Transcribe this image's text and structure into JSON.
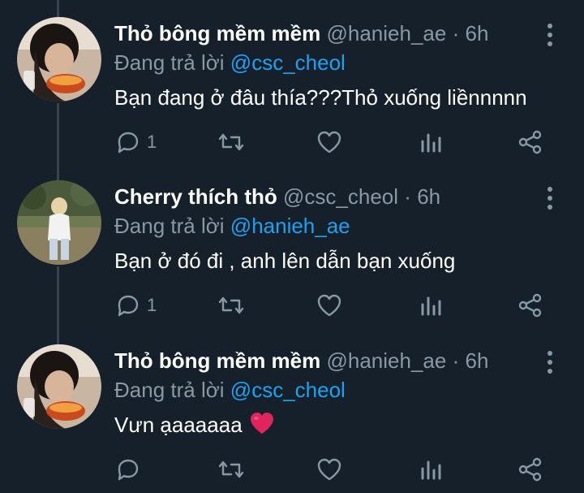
{
  "replying_to_label": "Đang trả lời",
  "colors": {
    "background": "#15202b",
    "secondary_text": "#8899a6",
    "accent": "#1da1f2",
    "heart": "#e0245e"
  },
  "tweets": [
    {
      "name": "Thỏ bông mềm mềm",
      "handle": "@hanieh_ae",
      "separator": "·",
      "time": "6h",
      "reply_to": "@csc_cheol",
      "text": "Bạn đang ở đâu thía???Thỏ xuống liềnnnnn",
      "reply_count": "1",
      "avatar": "avatar-eating-photo"
    },
    {
      "name": "Cherry thích thỏ",
      "handle": "@csc_cheol",
      "separator": "·",
      "time": "6h",
      "reply_to": "@hanieh_ae",
      "text": "Bạn ở đó đi , anh lên dẫn bạn xuống",
      "reply_count": "1",
      "avatar": "avatar-outdoor-photo"
    },
    {
      "name": "Thỏ bông mềm mềm",
      "handle": "@hanieh_ae",
      "separator": "·",
      "time": "6h",
      "reply_to": "@csc_cheol",
      "text": "Vưn ạaaaaaa",
      "emoji": "red-heart-emoji",
      "reply_count": "",
      "avatar": "avatar-eating-photo"
    }
  ]
}
